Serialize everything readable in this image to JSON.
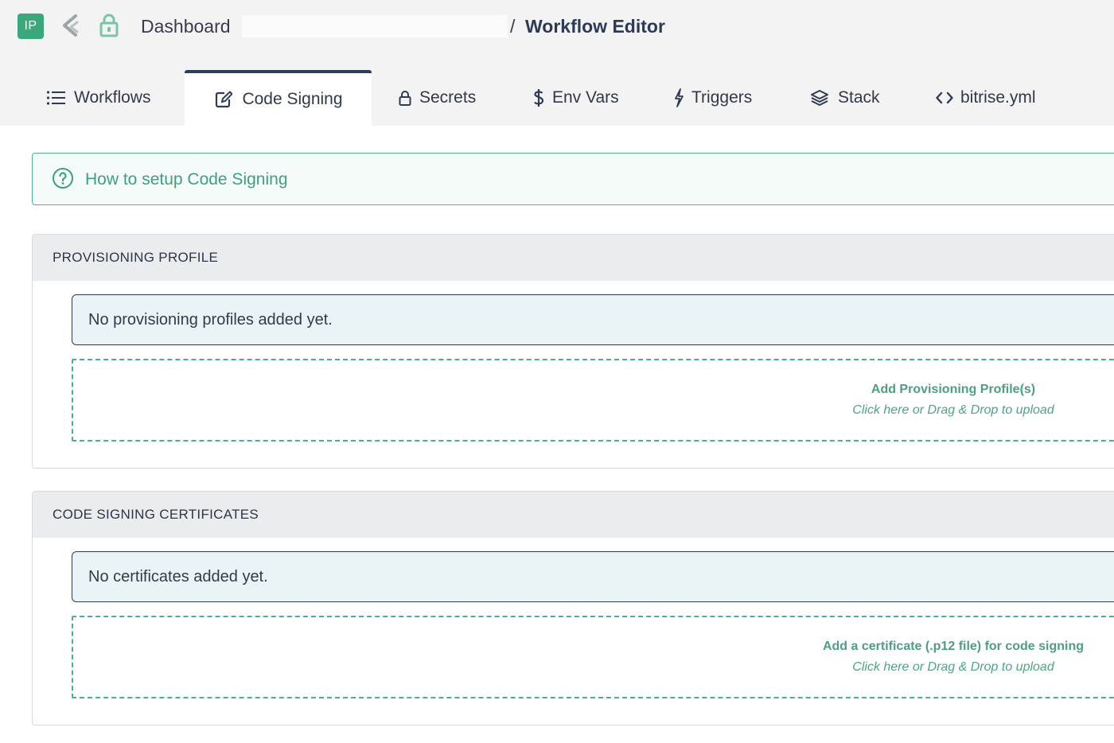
{
  "header": {
    "app_badge": "IP",
    "breadcrumb_dashboard": "Dashboard",
    "breadcrumb_separator": "/",
    "breadcrumb_current": "Workflow Editor",
    "icons": [
      "bitrise-logo-icon",
      "lock-icon"
    ]
  },
  "tabs": [
    {
      "label": "Workflows",
      "icon": "list-icon",
      "active": false
    },
    {
      "label": "Code Signing",
      "icon": "edit-icon",
      "active": true
    },
    {
      "label": "Secrets",
      "icon": "lock-icon",
      "active": false
    },
    {
      "label": "Env Vars",
      "icon": "dollar-icon",
      "active": false
    },
    {
      "label": "Triggers",
      "icon": "lightning-icon",
      "active": false
    },
    {
      "label": "Stack",
      "icon": "layers-icon",
      "active": false
    },
    {
      "label": "bitrise.yml",
      "icon": "code-icon",
      "active": false
    }
  ],
  "help": {
    "label": "How to setup Code Signing",
    "icon": "question-circle-icon"
  },
  "provisioning": {
    "header": "PROVISIONING PROFILE",
    "empty": "No provisioning profiles added yet.",
    "drop_title": "Add Provisioning Profile(s)",
    "drop_hint": "Click here or Drag & Drop to upload"
  },
  "certificates": {
    "header": "CODE SIGNING CERTIFICATES",
    "empty": "No certificates added yet.",
    "drop_title": "Add a certificate (.p12 file) for code signing",
    "drop_hint": "Click here or Drag & Drop to upload"
  },
  "colors": {
    "accent_green": "#3aa87a",
    "active_tab_border": "#2d3d5a",
    "help_text": "#3ea17c"
  }
}
